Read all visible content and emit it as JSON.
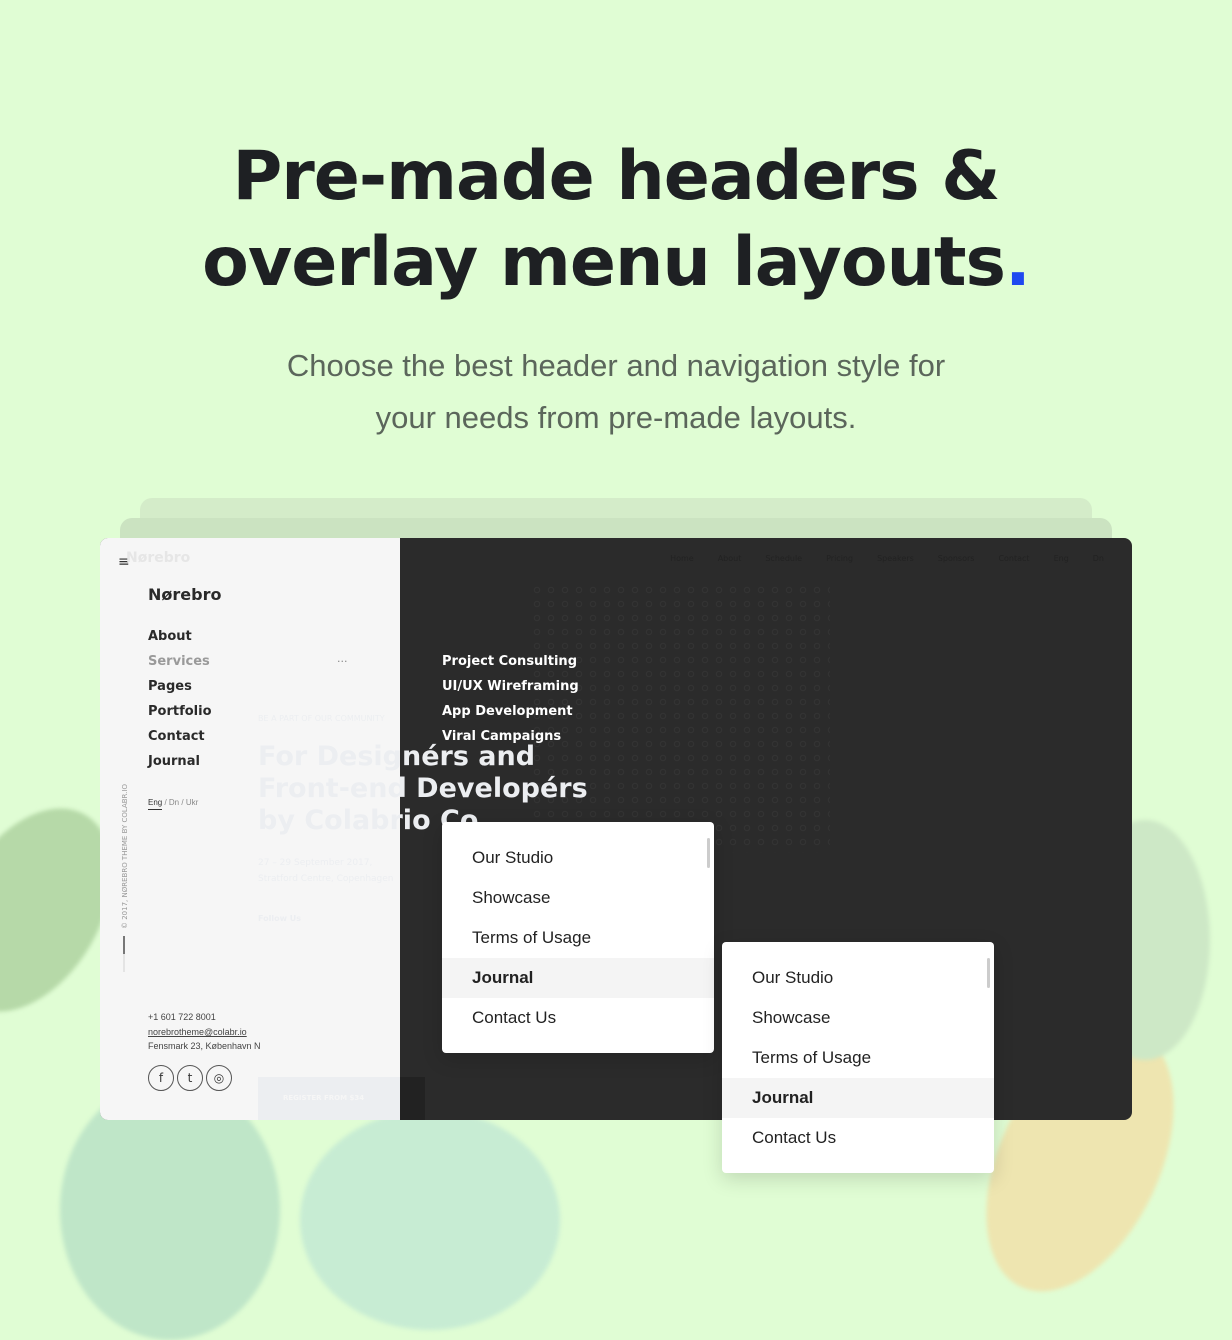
{
  "heading": {
    "line1": "Pre-made headers &",
    "line2": "overlay menu layouts",
    "dot": "."
  },
  "subtitle": {
    "line1": "Choose the best header and navigation style for",
    "line2": "your needs from pre-made layouts."
  },
  "colors": {
    "background": "#e0fdd4",
    "accent": "#1f48f0",
    "dark_panel": "#2b2b2b"
  },
  "window": {
    "brand": "Nørebro",
    "ghost_brand": "Nørebro",
    "top_nav": [
      "Home",
      "About",
      "Schedule",
      "Pricing",
      "Speakers",
      "Sponsors",
      "Contact",
      "Eng",
      "Dn"
    ],
    "menu": [
      "About",
      "Services",
      "Pages",
      "Portfolio",
      "Contact",
      "Journal"
    ],
    "active_menu": "Services",
    "more": "...",
    "submenu": [
      "Project Consulting",
      "UI/UX Wireframing",
      "App Development",
      "Viral Campaigns"
    ],
    "languages": [
      "Eng",
      "Dn",
      "Ukr"
    ],
    "vertical_copyright": "© 2017, NØREBRO THEME BY COLABR.IO",
    "phone": "+1 601 722 8001",
    "email": "norebrotheme@colabr.io",
    "address": "Fensmark 23, København N",
    "social": [
      {
        "icon": "facebook-icon",
        "glyph": "f"
      },
      {
        "icon": "twitter-icon",
        "glyph": "t"
      },
      {
        "icon": "instagram-icon",
        "glyph": "◎"
      }
    ],
    "hero_ghost": {
      "kicker": "BE A PART OF OUR COMMUNITY",
      "title1": "For Designérs and",
      "title2": "Front-end Developérs",
      "title3": "by Colabrio Co.",
      "date": "27 – 29 September 2017,",
      "venue": "Stratford Centre, Copenhagen",
      "follow": "Follow Us",
      "register": "REGISTER FROM $34"
    }
  },
  "dropdown1": {
    "items": [
      "Our Studio",
      "Showcase",
      "Terms of Usage",
      "Journal",
      "Contact Us"
    ],
    "active": "Journal"
  },
  "dropdown2": {
    "items": [
      "Our Studio",
      "Showcase",
      "Terms of Usage",
      "Journal",
      "Contact Us"
    ],
    "active": "Journal"
  }
}
